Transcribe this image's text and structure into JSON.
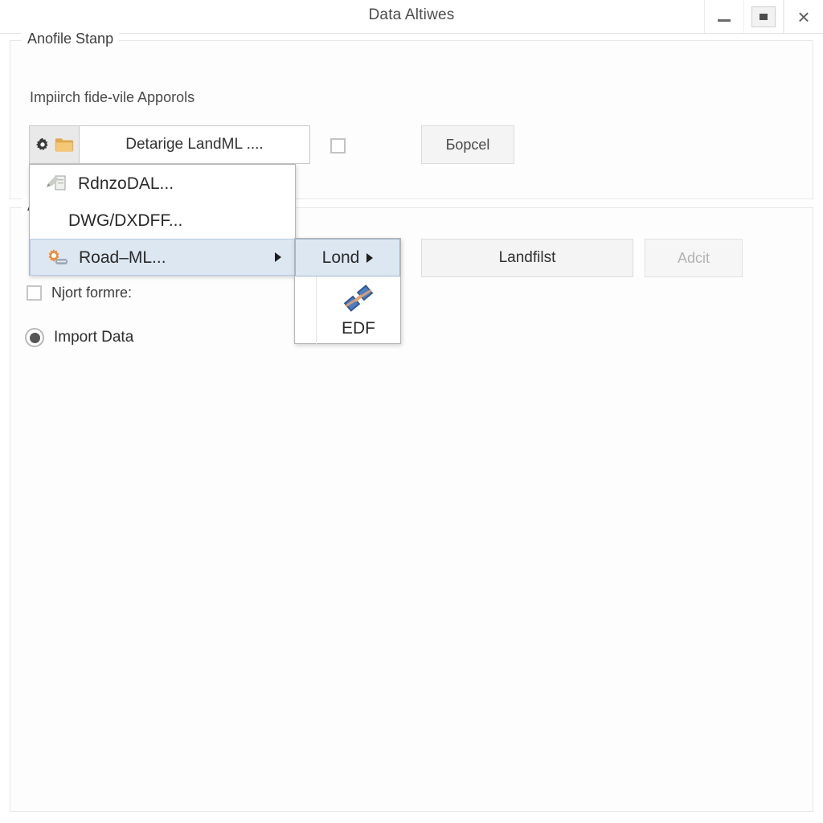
{
  "window": {
    "title": "Data Altiwes",
    "controls": {
      "minimize": "minimize-icon",
      "maximize": "maximize-icon",
      "close": "×"
    }
  },
  "group_top": {
    "legend": "Anofile Stanp",
    "sub_label": "Impiirch fide-vile Apporols",
    "combo": {
      "value": "Detarige LandML ....",
      "gear_icon": "gear-icon",
      "folder_icon": "folder-icon"
    },
    "checkbox_small": {
      "checked": false
    },
    "cancel_button": "Бopсel"
  },
  "group_bottom": {
    "legend": "A",
    "checkbox": {
      "label": "Njort formre:",
      "checked": false
    },
    "radio": {
      "label": "Import Data",
      "selected": true
    },
    "primary_button": "Landfilst",
    "secondary_button": "Adcit"
  },
  "menu": {
    "items": [
      {
        "label": "RdnzoDAL...",
        "icon": "document-pencil-icon",
        "selected": false,
        "submenu": false
      },
      {
        "label": "DWG/DXDFF...",
        "icon": "",
        "selected": false,
        "submenu": false
      },
      {
        "label": "Road–ML...",
        "icon": "road-gear-icon",
        "selected": true,
        "submenu": true
      }
    ]
  },
  "submenu": {
    "items": [
      {
        "label": "Lond",
        "selected": true,
        "submenu": true
      }
    ],
    "tile": {
      "label": "EDF",
      "icon": "edf-file-icon"
    }
  },
  "colors": {
    "accent": "#dde7f2",
    "accent_border": "#b6cbe2",
    "folder": "#e8b556",
    "text": "#2a2a2a",
    "disabled_text": "#b2b2b2"
  }
}
